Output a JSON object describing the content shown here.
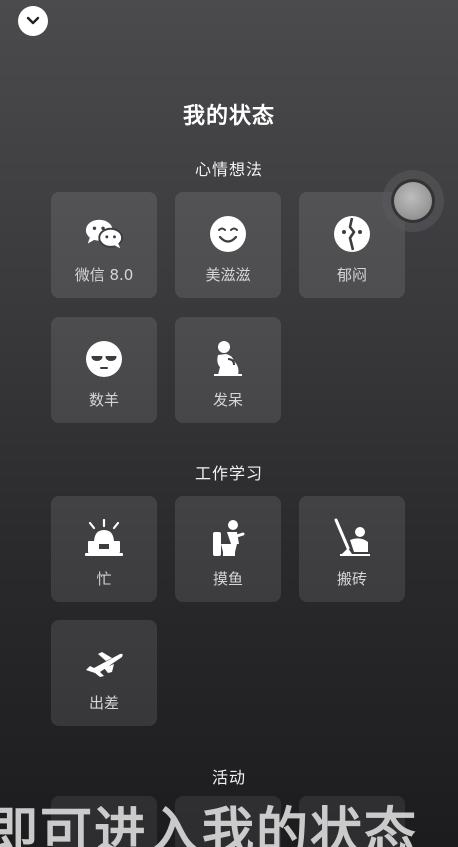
{
  "page_title": "我的状态",
  "sections": [
    {
      "title": "心情想法",
      "items": [
        {
          "label": "微信 8.0",
          "icon": "wechat-icon"
        },
        {
          "label": "美滋滋",
          "icon": "smile-face-icon"
        },
        {
          "label": "郁闷",
          "icon": "broken-heart-face-icon"
        },
        {
          "label": "数羊",
          "icon": "sleepy-face-icon"
        },
        {
          "label": "发呆",
          "icon": "daze-figure-icon"
        }
      ]
    },
    {
      "title": "工作学习",
      "items": [
        {
          "label": "忙",
          "icon": "alarm-laptop-icon"
        },
        {
          "label": "摸鱼",
          "icon": "toilet-figure-icon"
        },
        {
          "label": "搬砖",
          "icon": "worker-figure-icon"
        },
        {
          "label": "出差",
          "icon": "airplane-icon"
        }
      ]
    },
    {
      "title": "活动",
      "items": []
    }
  ],
  "subtitle_caption": "即可进入我的状态",
  "colors": {
    "tile_bg": "rgba(255,255,255,0.10)",
    "label": "#d6d6d6"
  }
}
